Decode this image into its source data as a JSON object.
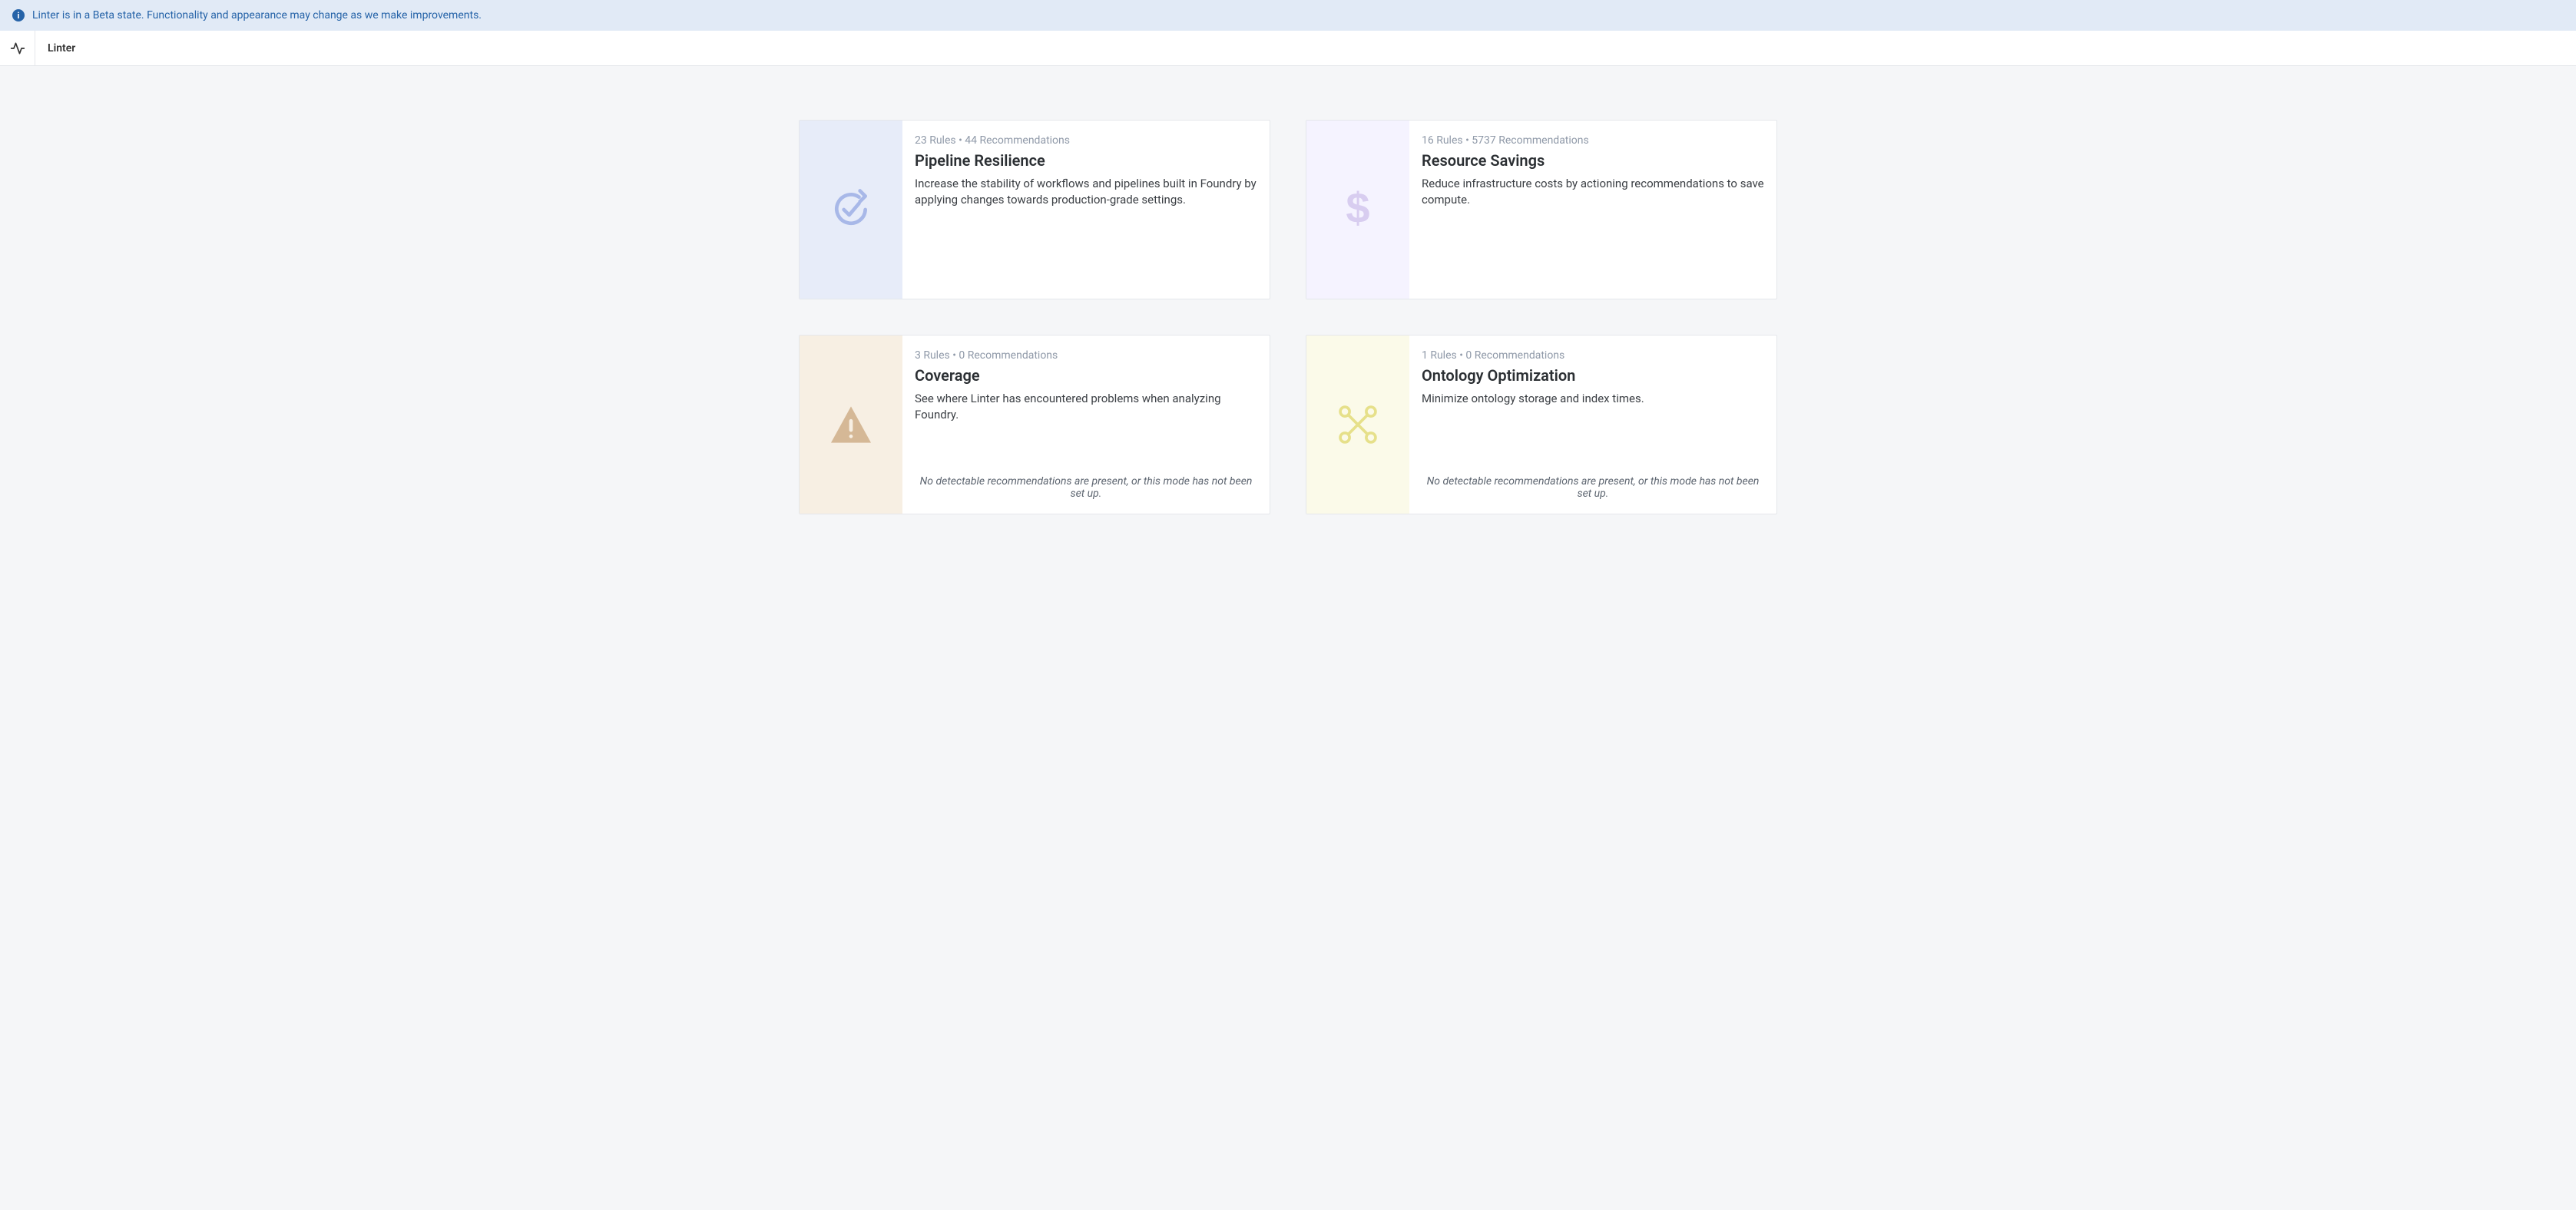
{
  "banner": {
    "text": "Linter is in a Beta state. Functionality and appearance may change as we make improvements."
  },
  "header": {
    "title": "Linter"
  },
  "empty_message": "No detectable recommendations are present, or this mode has not been set up.",
  "cards": {
    "pipeline": {
      "meta": "23 Rules  •  44 Recommendations",
      "title": "Pipeline Resilience",
      "desc": "Increase the stability of workflows and pipelines built in Foundry by applying changes towards production-grade settings."
    },
    "resource": {
      "meta": "16 Rules  •  5737 Recommendations",
      "title": "Resource Savings",
      "desc": "Reduce infrastructure costs by actioning recommendations to save compute."
    },
    "coverage": {
      "meta": "3 Rules  •  0 Recommendations",
      "title": "Coverage",
      "desc": "See where Linter has encountered problems when analyzing Foundry."
    },
    "ontology": {
      "meta": "1 Rules  •  0 Recommendations",
      "title": "Ontology Optimization",
      "desc": "Minimize ontology storage and index times."
    }
  }
}
